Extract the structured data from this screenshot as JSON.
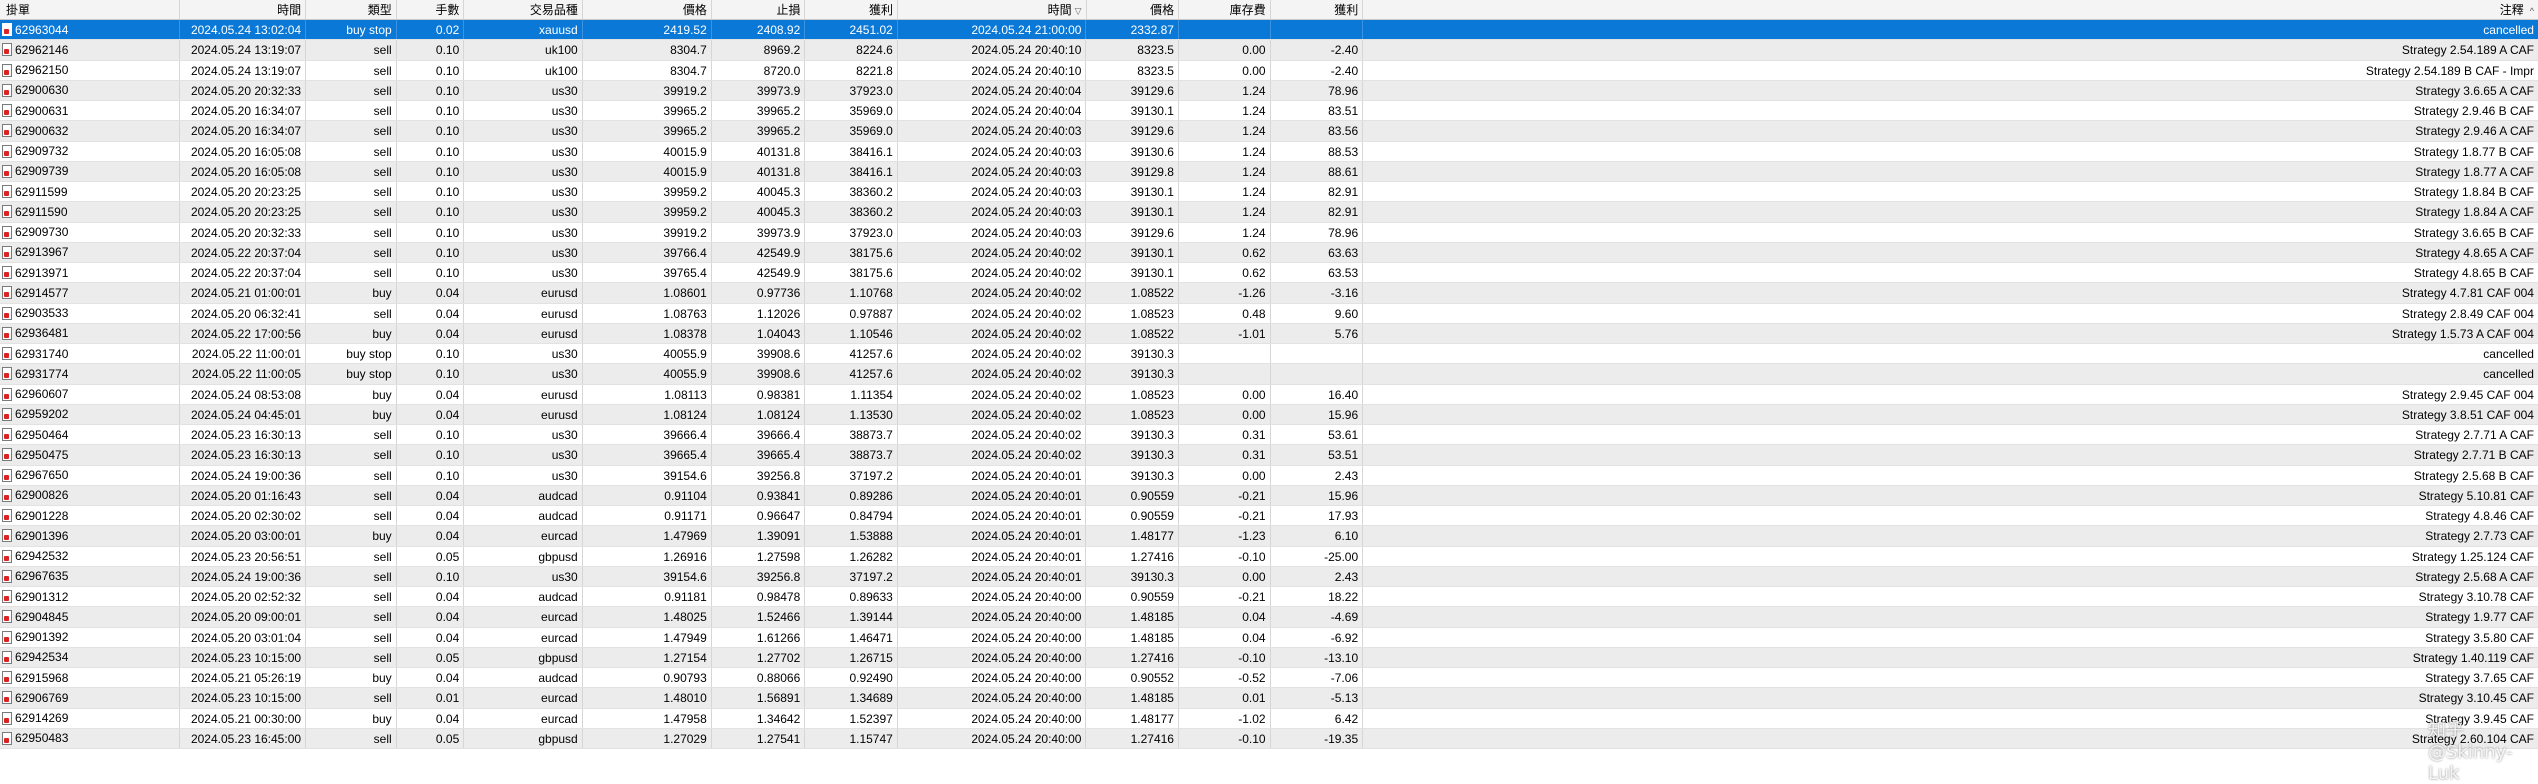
{
  "table": {
    "headers": [
      "掛單",
      "時間",
      "類型",
      "手數",
      "交易品種",
      "價格",
      "止損",
      "獲利",
      "時間",
      "價格",
      "庫存費",
      "獲利",
      "注釋"
    ],
    "sort_icon": "sort-down-icon",
    "rows": [
      [
        "62963044",
        "2024.05.24 13:02:04",
        "buy stop",
        "0.02",
        "xauusd",
        "2419.52",
        "2408.92",
        "2451.02",
        "2024.05.24 21:00:00",
        "2332.87",
        "",
        "",
        "cancelled"
      ],
      [
        "62962146",
        "2024.05.24 13:19:07",
        "sell",
        "0.10",
        "uk100",
        "8304.7",
        "8969.2",
        "8224.6",
        "2024.05.24 20:40:10",
        "8323.5",
        "0.00",
        "-2.40",
        "Strategy 2.54.189 A CAF"
      ],
      [
        "62962150",
        "2024.05.24 13:19:07",
        "sell",
        "0.10",
        "uk100",
        "8304.7",
        "8720.0",
        "8221.8",
        "2024.05.24 20:40:10",
        "8323.5",
        "0.00",
        "-2.40",
        "Strategy 2.54.189 B CAF - Impr"
      ],
      [
        "62900630",
        "2024.05.20 20:32:33",
        "sell",
        "0.10",
        "us30",
        "39919.2",
        "39973.9",
        "37923.0",
        "2024.05.24 20:40:04",
        "39129.6",
        "1.24",
        "78.96",
        "Strategy 3.6.65 A CAF"
      ],
      [
        "62900631",
        "2024.05.20 16:34:07",
        "sell",
        "0.10",
        "us30",
        "39965.2",
        "39965.2",
        "35969.0",
        "2024.05.24 20:40:04",
        "39130.1",
        "1.24",
        "83.51",
        "Strategy 2.9.46 B CAF"
      ],
      [
        "62900632",
        "2024.05.20 16:34:07",
        "sell",
        "0.10",
        "us30",
        "39965.2",
        "39965.2",
        "35969.0",
        "2024.05.24 20:40:03",
        "39129.6",
        "1.24",
        "83.56",
        "Strategy 2.9.46 A CAF"
      ],
      [
        "62909732",
        "2024.05.20 16:05:08",
        "sell",
        "0.10",
        "us30",
        "40015.9",
        "40131.8",
        "38416.1",
        "2024.05.24 20:40:03",
        "39130.6",
        "1.24",
        "88.53",
        "Strategy 1.8.77 B CAF"
      ],
      [
        "62909739",
        "2024.05.20 16:05:08",
        "sell",
        "0.10",
        "us30",
        "40015.9",
        "40131.8",
        "38416.1",
        "2024.05.24 20:40:03",
        "39129.8",
        "1.24",
        "88.61",
        "Strategy 1.8.77 A CAF"
      ],
      [
        "62911599",
        "2024.05.20 20:23:25",
        "sell",
        "0.10",
        "us30",
        "39959.2",
        "40045.3",
        "38360.2",
        "2024.05.24 20:40:03",
        "39130.1",
        "1.24",
        "82.91",
        "Strategy 1.8.84 B CAF"
      ],
      [
        "62911590",
        "2024.05.20 20:23:25",
        "sell",
        "0.10",
        "us30",
        "39959.2",
        "40045.3",
        "38360.2",
        "2024.05.24 20:40:03",
        "39130.1",
        "1.24",
        "82.91",
        "Strategy 1.8.84 A CAF"
      ],
      [
        "62909730",
        "2024.05.20 20:32:33",
        "sell",
        "0.10",
        "us30",
        "39919.2",
        "39973.9",
        "37923.0",
        "2024.05.24 20:40:03",
        "39129.6",
        "1.24",
        "78.96",
        "Strategy 3.6.65 B CAF"
      ],
      [
        "62913967",
        "2024.05.22 20:37:04",
        "sell",
        "0.10",
        "us30",
        "39766.4",
        "42549.9",
        "38175.6",
        "2024.05.24 20:40:02",
        "39130.1",
        "0.62",
        "63.63",
        "Strategy 4.8.65 A CAF"
      ],
      [
        "62913971",
        "2024.05.22 20:37:04",
        "sell",
        "0.10",
        "us30",
        "39765.4",
        "42549.9",
        "38175.6",
        "2024.05.24 20:40:02",
        "39130.1",
        "0.62",
        "63.53",
        "Strategy 4.8.65 B CAF"
      ],
      [
        "62914577",
        "2024.05.21 01:00:01",
        "buy",
        "0.04",
        "eurusd",
        "1.08601",
        "0.97736",
        "1.10768",
        "2024.05.24 20:40:02",
        "1.08522",
        "-1.26",
        "-3.16",
        "Strategy 4.7.81 CAF 004"
      ],
      [
        "62903533",
        "2024.05.20 06:32:41",
        "sell",
        "0.04",
        "eurusd",
        "1.08763",
        "1.12026",
        "0.97887",
        "2024.05.24 20:40:02",
        "1.08523",
        "0.48",
        "9.60",
        "Strategy 2.8.49 CAF 004"
      ],
      [
        "62936481",
        "2024.05.22 17:00:56",
        "buy",
        "0.04",
        "eurusd",
        "1.08378",
        "1.04043",
        "1.10546",
        "2024.05.24 20:40:02",
        "1.08522",
        "-1.01",
        "5.76",
        "Strategy 1.5.73 A CAF 004"
      ],
      [
        "62931740",
        "2024.05.22 11:00:01",
        "buy stop",
        "0.10",
        "us30",
        "40055.9",
        "39908.6",
        "41257.6",
        "2024.05.24 20:40:02",
        "39130.3",
        "",
        "",
        "cancelled"
      ],
      [
        "62931774",
        "2024.05.22 11:00:05",
        "buy stop",
        "0.10",
        "us30",
        "40055.9",
        "39908.6",
        "41257.6",
        "2024.05.24 20:40:02",
        "39130.3",
        "",
        "",
        "cancelled"
      ],
      [
        "62960607",
        "2024.05.24 08:53:08",
        "buy",
        "0.04",
        "eurusd",
        "1.08113",
        "0.98381",
        "1.11354",
        "2024.05.24 20:40:02",
        "1.08523",
        "0.00",
        "16.40",
        "Strategy 2.9.45 CAF 004"
      ],
      [
        "62959202",
        "2024.05.24 04:45:01",
        "buy",
        "0.04",
        "eurusd",
        "1.08124",
        "1.08124",
        "1.13530",
        "2024.05.24 20:40:02",
        "1.08523",
        "0.00",
        "15.96",
        "Strategy 3.8.51 CAF 004"
      ],
      [
        "62950464",
        "2024.05.23 16:30:13",
        "sell",
        "0.10",
        "us30",
        "39666.4",
        "39666.4",
        "38873.7",
        "2024.05.24 20:40:02",
        "39130.3",
        "0.31",
        "53.61",
        "Strategy 2.7.71 A CAF"
      ],
      [
        "62950475",
        "2024.05.23 16:30:13",
        "sell",
        "0.10",
        "us30",
        "39665.4",
        "39665.4",
        "38873.7",
        "2024.05.24 20:40:02",
        "39130.3",
        "0.31",
        "53.51",
        "Strategy 2.7.71 B CAF"
      ],
      [
        "62967650",
        "2024.05.24 19:00:36",
        "sell",
        "0.10",
        "us30",
        "39154.6",
        "39256.8",
        "37197.2",
        "2024.05.24 20:40:01",
        "39130.3",
        "0.00",
        "2.43",
        "Strategy 2.5.68 B CAF"
      ],
      [
        "62900826",
        "2024.05.20 01:16:43",
        "sell",
        "0.04",
        "audcad",
        "0.91104",
        "0.93841",
        "0.89286",
        "2024.05.24 20:40:01",
        "0.90559",
        "-0.21",
        "15.96",
        "Strategy 5.10.81 CAF"
      ],
      [
        "62901228",
        "2024.05.20 02:30:02",
        "sell",
        "0.04",
        "audcad",
        "0.91171",
        "0.96647",
        "0.84794",
        "2024.05.24 20:40:01",
        "0.90559",
        "-0.21",
        "17.93",
        "Strategy 4.8.46 CAF"
      ],
      [
        "62901396",
        "2024.05.20 03:00:01",
        "buy",
        "0.04",
        "eurcad",
        "1.47969",
        "1.39091",
        "1.53888",
        "2024.05.24 20:40:01",
        "1.48177",
        "-1.23",
        "6.10",
        "Strategy 2.7.73 CAF"
      ],
      [
        "62942532",
        "2024.05.23 20:56:51",
        "sell",
        "0.05",
        "gbpusd",
        "1.26916",
        "1.27598",
        "1.26282",
        "2024.05.24 20:40:01",
        "1.27416",
        "-0.10",
        "-25.00",
        "Strategy 1.25.124 CAF"
      ],
      [
        "62967635",
        "2024.05.24 19:00:36",
        "sell",
        "0.10",
        "us30",
        "39154.6",
        "39256.8",
        "37197.2",
        "2024.05.24 20:40:01",
        "39130.3",
        "0.00",
        "2.43",
        "Strategy 2.5.68 A CAF"
      ],
      [
        "62901312",
        "2024.05.20 02:52:32",
        "sell",
        "0.04",
        "audcad",
        "0.91181",
        "0.98478",
        "0.89633",
        "2024.05.24 20:40:00",
        "0.90559",
        "-0.21",
        "18.22",
        "Strategy 3.10.78 CAF"
      ],
      [
        "62904845",
        "2024.05.20 09:00:01",
        "sell",
        "0.04",
        "eurcad",
        "1.48025",
        "1.52466",
        "1.39144",
        "2024.05.24 20:40:00",
        "1.48185",
        "0.04",
        "-4.69",
        "Strategy 1.9.77 CAF"
      ],
      [
        "62901392",
        "2024.05.20 03:01:04",
        "sell",
        "0.04",
        "eurcad",
        "1.47949",
        "1.61266",
        "1.46471",
        "2024.05.24 20:40:00",
        "1.48185",
        "0.04",
        "-6.92",
        "Strategy 3.5.80 CAF"
      ],
      [
        "62942534",
        "2024.05.23 10:15:00",
        "sell",
        "0.05",
        "gbpusd",
        "1.27154",
        "1.27702",
        "1.26715",
        "2024.05.24 20:40:00",
        "1.27416",
        "-0.10",
        "-13.10",
        "Strategy 1.40.119 CAF"
      ],
      [
        "62915968",
        "2024.05.21 05:26:19",
        "buy",
        "0.04",
        "audcad",
        "0.90793",
        "0.88066",
        "0.92490",
        "2024.05.24 20:40:00",
        "0.90552",
        "-0.52",
        "-7.06",
        "Strategy 3.7.65 CAF"
      ],
      [
        "62906769",
        "2024.05.23 10:15:00",
        "sell",
        "0.01",
        "eurcad",
        "1.48010",
        "1.56891",
        "1.34689",
        "2024.05.24 20:40:00",
        "1.48185",
        "0.01",
        "-5.13",
        "Strategy 3.10.45 CAF"
      ],
      [
        "62914269",
        "2024.05.21 00:30:00",
        "buy",
        "0.04",
        "eurcad",
        "1.47958",
        "1.34642",
        "1.52397",
        "2024.05.24 20:40:00",
        "1.48177",
        "-1.02",
        "6.42",
        "Strategy 3.9.45 CAF"
      ],
      [
        "62950483",
        "2024.05.23 16:45:00",
        "sell",
        "0.05",
        "gbpusd",
        "1.27029",
        "1.27541",
        "1.15747",
        "2024.05.24 20:40:00",
        "1.27416",
        "-0.10",
        "-19.35",
        "Strategy 2.60.104 CAF"
      ]
    ]
  },
  "watermark": {
    "text": "知乎 @Skinny-Luk"
  }
}
